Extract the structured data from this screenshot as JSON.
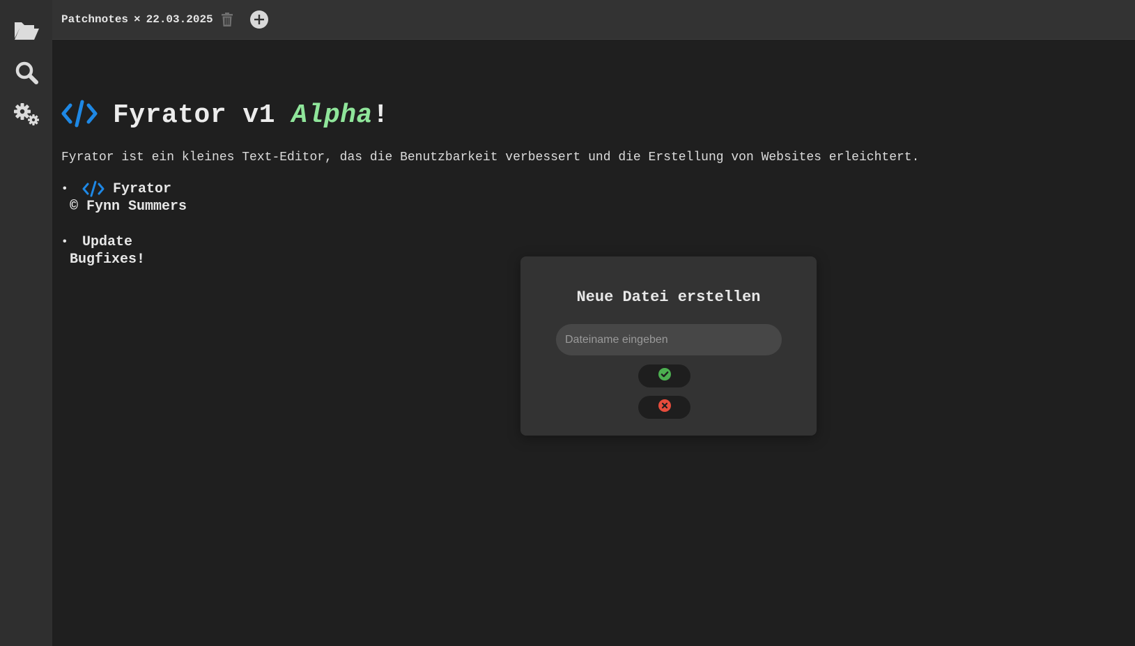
{
  "sidebar": {
    "items": [
      {
        "name": "open-folder",
        "icon": "folder-open-icon"
      },
      {
        "name": "search",
        "icon": "search-icon"
      },
      {
        "name": "settings",
        "icon": "gears-icon"
      }
    ]
  },
  "tabbar": {
    "tab_name": "Patchnotes",
    "tab_separator": "×",
    "tab_date": "22.03.2025",
    "delete_icon": "trash-icon",
    "add_icon": "plus-circle-icon"
  },
  "document": {
    "title_prefix": "Fyrator v1 ",
    "title_accent": "Alpha",
    "title_suffix": "!",
    "description": "Fyrator ist ein kleines Text-Editor, das die Benutzbarkeit verbessert und die Erstellung von Websites erleichtert.",
    "list": [
      {
        "line1": "Fyrator",
        "line2": "© Fynn Summers"
      },
      {
        "line1": "Update",
        "line2": "Bugfixes!"
      }
    ],
    "bullet": "•"
  },
  "modal": {
    "title": "Neue Datei erstellen",
    "input_placeholder": "Dateiname eingeben",
    "input_value": "",
    "confirm_icon": "check-circle-icon",
    "cancel_icon": "x-circle-icon"
  },
  "colors": {
    "code_icon": "#1e88e5",
    "accent_green": "#8fe59a",
    "confirm": "#4caf50",
    "cancel": "#e74c3c",
    "sidebar_bg": "#2f2f2f",
    "editor_bg": "#1f1f1f"
  }
}
